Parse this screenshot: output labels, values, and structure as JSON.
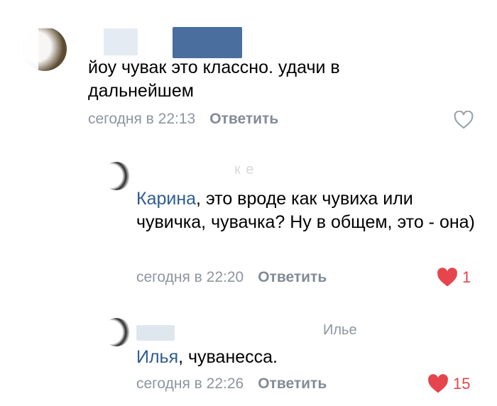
{
  "colors": {
    "mention": "#2f5d8f",
    "meta": "#8d95a0",
    "like_active": "#e6454d",
    "like_inactive": "#9aa2ab"
  },
  "comments": [
    {
      "text": "йоу чувак это классно. удачи в дальнейшем",
      "time": "сегодня в 22:13",
      "reply_label": "Ответить",
      "like_icon": "heart-outline-icon"
    },
    {
      "author_fragment": "к  е",
      "mention": "Карина",
      "text": ", это вроде как чувиха или чувичка, чувачка? Ну в общем, это - она)",
      "time": "сегодня в 22:20",
      "reply_label": "Ответить",
      "like_icon": "heart-filled-icon",
      "likes": "1"
    },
    {
      "author_fragment": "Илье",
      "mention": "Илья",
      "text": ", чуванесса.",
      "time": "сегодня в 22:26",
      "reply_label": "Ответить",
      "like_icon": "heart-filled-icon",
      "likes": "15"
    }
  ]
}
